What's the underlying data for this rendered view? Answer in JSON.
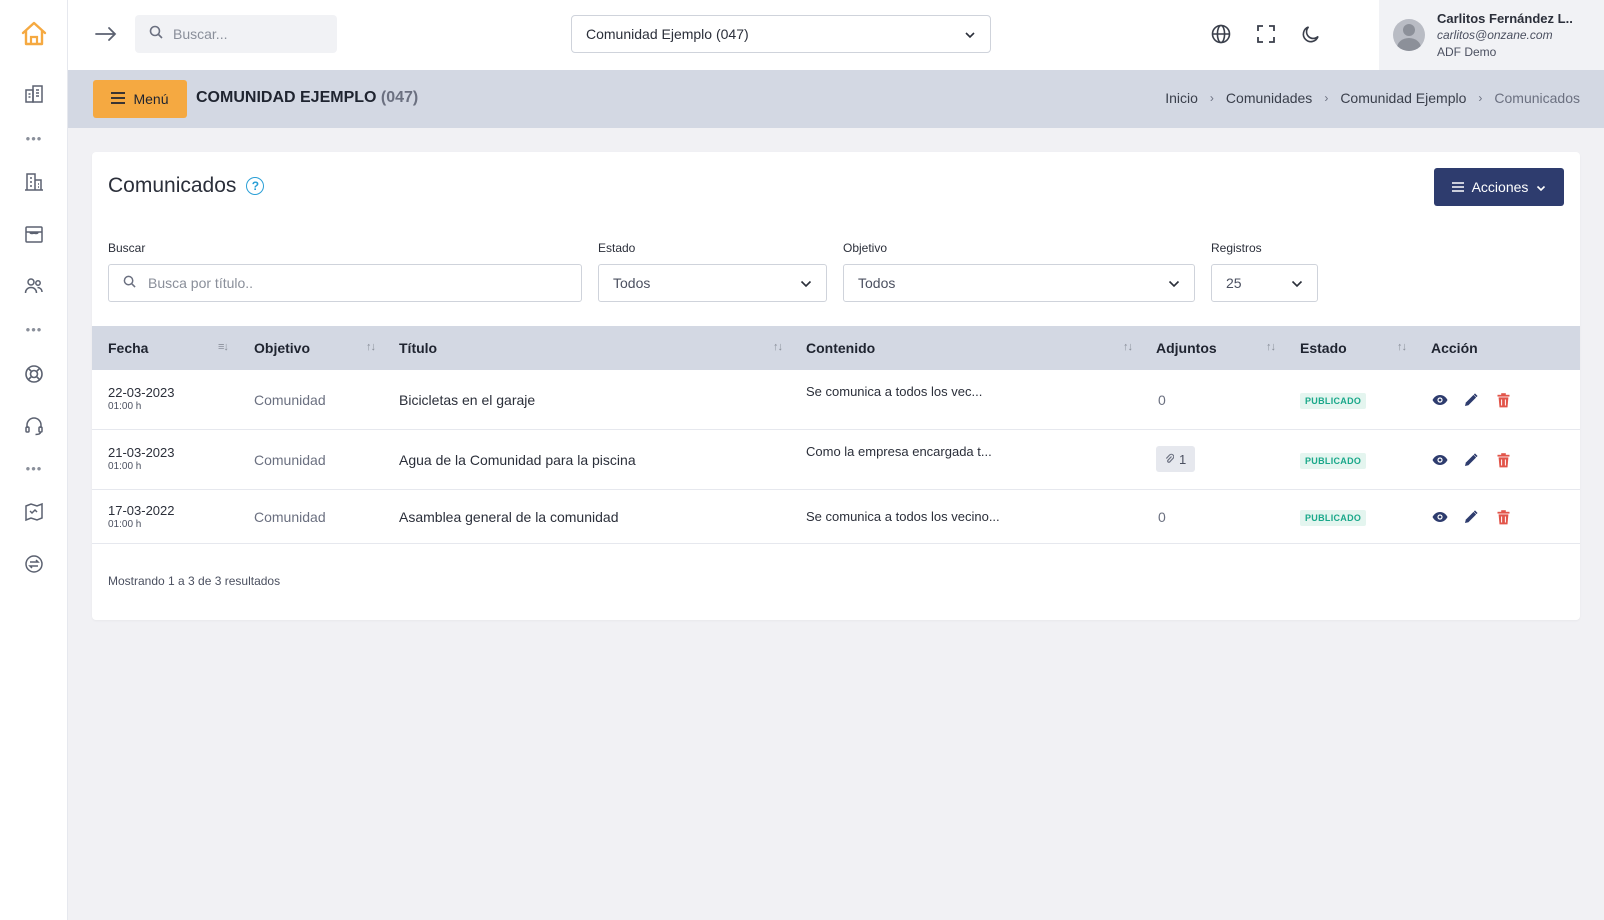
{
  "topbar": {
    "search_placeholder": "Buscar...",
    "community_selected": "Comunidad Ejemplo (047)",
    "user": {
      "name": "Carlitos Fernández L..",
      "email": "carlitos@onzane.com",
      "org": "ADF Demo"
    }
  },
  "subheader": {
    "menu_label": "Menú",
    "title": "COMUNIDAD EJEMPLO",
    "code": "(047)",
    "breadcrumb": [
      "Inicio",
      "Comunidades",
      "Comunidad Ejemplo",
      "Comunicados"
    ]
  },
  "page": {
    "title": "Comunicados",
    "help_glyph": "?",
    "actions_label": "Acciones"
  },
  "filters": {
    "search_label": "Buscar",
    "search_placeholder": "Busca por título..",
    "estado_label": "Estado",
    "estado_value": "Todos",
    "objetivo_label": "Objetivo",
    "objetivo_value": "Todos",
    "registros_label": "Registros",
    "registros_value": "25"
  },
  "table": {
    "columns": [
      "Fecha",
      "Objetivo",
      "Título",
      "Contenido",
      "Adjuntos",
      "Estado",
      "Acción"
    ],
    "rows": [
      {
        "date": "22-03-2023",
        "time": "01:00 h",
        "objetivo": "Comunidad",
        "titulo": "Bicicletas en el garaje",
        "contenido": "Se comunica a todos los vec...",
        "adjuntos": "0",
        "estado": "PUBLICADO"
      },
      {
        "date": "21-03-2023",
        "time": "01:00 h",
        "objetivo": "Comunidad",
        "titulo": "Agua de la Comunidad para la piscina",
        "contenido": "Como la empresa encargada t...",
        "adjuntos": "1",
        "estado": "PUBLICADO"
      },
      {
        "date": "17-03-2022",
        "time": "01:00 h",
        "objetivo": "Comunidad",
        "titulo": "Asamblea general de la comunidad",
        "contenido": "Se comunica a todos los vecino...",
        "adjuntos": "0",
        "estado": "PUBLICADO"
      }
    ],
    "footer": "Mostrando 1 a 3 de 3 resultados"
  },
  "colors": {
    "accent_orange": "#f5a941",
    "primary_navy": "#2e3c6e",
    "status_green": "#1aa88a",
    "delete_red": "#e2554a"
  },
  "icons": {
    "rail": [
      "home-icon",
      "buildings-icon",
      "building-icon",
      "store-icon",
      "users-icon",
      "lifebuoy-icon",
      "headset-icon",
      "map-icon",
      "exchange-icon"
    ],
    "topbar": [
      "arrow-right-icon",
      "search-icon",
      "chevron-down-icon",
      "globe-icon",
      "fullscreen-icon",
      "moon-icon"
    ]
  }
}
